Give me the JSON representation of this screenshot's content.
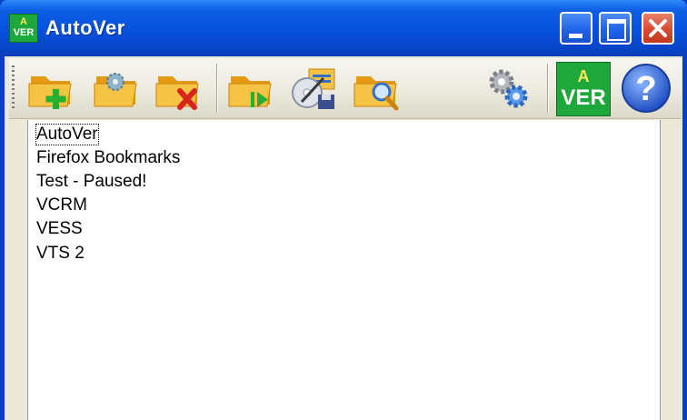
{
  "window": {
    "title": "AutoVer",
    "icon": {
      "name": "autover-app-icon",
      "top_text": "A",
      "bottom_text": "VER"
    },
    "controls": [
      {
        "name": "minimize-button"
      },
      {
        "name": "maximize-button"
      },
      {
        "name": "close-button"
      }
    ]
  },
  "toolbar": {
    "buttons": [
      {
        "name": "add-folder-button",
        "icon": "folder-add-icon"
      },
      {
        "name": "edit-folder-button",
        "icon": "folder-gear-icon"
      },
      {
        "name": "delete-folder-button",
        "icon": "folder-delete-icon"
      },
      {
        "name": "run-folder-button",
        "icon": "folder-play-icon"
      },
      {
        "name": "backup-restore-button",
        "icon": "disk-edit-icon"
      },
      {
        "name": "browse-folder-button",
        "icon": "folder-search-icon"
      },
      {
        "name": "settings-button",
        "icon": "gears-icon"
      },
      {
        "name": "about-autover-button",
        "icon": "autover-logo-icon",
        "top_text": "A",
        "bottom_text": "VER"
      },
      {
        "name": "help-button",
        "icon": "help-icon",
        "glyph": "?"
      }
    ]
  },
  "list": {
    "items": [
      {
        "label": "AutoVer",
        "focused": true
      },
      {
        "label": "Firefox Bookmarks"
      },
      {
        "label": "Test - Paused!"
      },
      {
        "label": "VCRM"
      },
      {
        "label": "VESS"
      },
      {
        "label": "VTS 2"
      }
    ]
  },
  "colors": {
    "titlebar": "#0650dc",
    "close_button": "#d6482c",
    "logo_green": "#1ea83c",
    "folder_yellow": "#f6b62c",
    "list_bg": "#ffffff",
    "frame_bg": "#ece9d8"
  }
}
